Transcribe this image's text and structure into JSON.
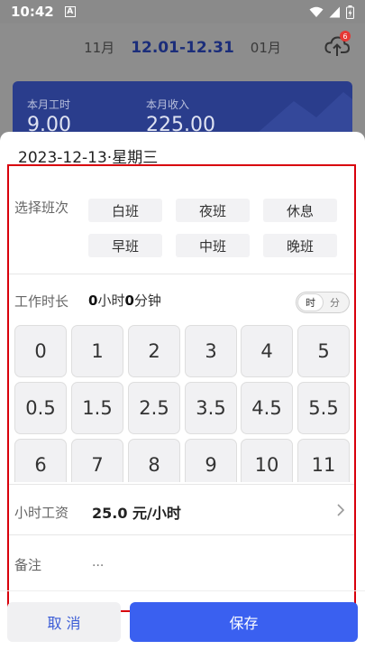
{
  "status_bar": {
    "time": "10:42",
    "notif_letter": "A"
  },
  "header": {
    "prev_month": "11月",
    "current_range": "12.01-12.31",
    "next_month": "01月",
    "badge_count": "6",
    "hours_label": "本月工时",
    "hours_value": "9.00",
    "income_label": "本月收入",
    "income_value": "225.00"
  },
  "sheet": {
    "date_title": "2023-12-13·星期三",
    "shift_label": "选择班次",
    "shifts": [
      "白班",
      "夜班",
      "休息",
      "早班",
      "中班",
      "晚班"
    ],
    "duration_label": "工作时长",
    "duration": {
      "hours": "0",
      "hours_unit": "小时",
      "minutes": "0",
      "minutes_unit": "分钟"
    },
    "toggle": {
      "hour": "时",
      "minute": "分",
      "active": "hour"
    },
    "keys": [
      "0",
      "1",
      "2",
      "3",
      "4",
      "5",
      "0.5",
      "1.5",
      "2.5",
      "3.5",
      "4.5",
      "5.5",
      "6",
      "7",
      "8",
      "9",
      "10",
      "11"
    ],
    "wage_label": "小时工资",
    "wage_value": "25.0 元/小时",
    "note_label": "备注",
    "note_placeholder": "...",
    "cancel_label": "取 消",
    "save_label": "保存"
  },
  "colors": {
    "accent": "#3a60f0",
    "highlight_frame": "#d8000c",
    "brand_dark": "#2a3d8c"
  }
}
